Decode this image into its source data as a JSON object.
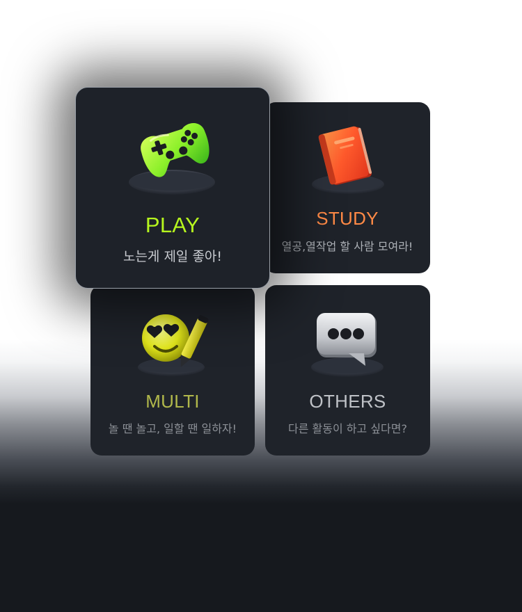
{
  "cards": {
    "play": {
      "title": "PLAY",
      "subtitle": "노는게 제일 좋아!",
      "icon": "gamepad-icon",
      "accent_color": "#b6f61e",
      "selected": true
    },
    "study": {
      "title": "STUDY",
      "subtitle": "열공,열작업 할 사람 모여라!",
      "icon": "book-icon",
      "accent_color": "#ff8a46"
    },
    "multi": {
      "title": "MULTI",
      "subtitle": "놀 땐 놀고, 일할 땐 일하자!",
      "icon": "heart-eyes-emoji-pencil-icon",
      "accent_color": "#b1b84b"
    },
    "others": {
      "title": "OTHERS",
      "subtitle": "다른 활동이 하고 싶다면?",
      "icon": "chat-bubble-icon",
      "accent_color": "#bfc2c7"
    }
  },
  "colors": {
    "card_background": "#1f232a",
    "page_dark": "#16191e",
    "page_light": "#ffffff"
  }
}
